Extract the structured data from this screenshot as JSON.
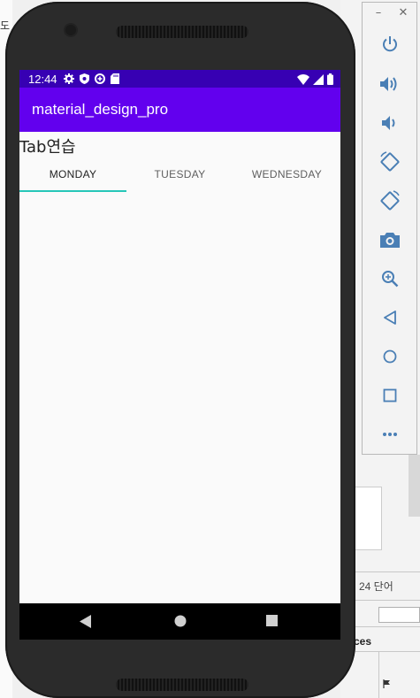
{
  "background": {
    "word_count": "24 단어",
    "panel_fragment": "ces",
    "left_fragment": "도"
  },
  "status_bar": {
    "time": "12:44",
    "bg_color": "#3700b3"
  },
  "app_bar": {
    "title": "material_design_pro",
    "bg_color": "#6200ee"
  },
  "content": {
    "heading": "Tab연습"
  },
  "tabs": [
    {
      "label": "MONDAY",
      "active": true
    },
    {
      "label": "TUESDAY",
      "active": false
    },
    {
      "label": "WEDNESDAY",
      "active": false
    }
  ],
  "tab_indicator_color": "#26c6b8",
  "nav_bar": {
    "buttons": [
      "back-icon",
      "home-icon",
      "recents-icon"
    ]
  },
  "emulator_toolbar": {
    "window_controls": {
      "minimize": "–",
      "close": "✕"
    },
    "buttons": [
      "power-icon",
      "volume-up-icon",
      "volume-down-icon",
      "rotate-left-icon",
      "rotate-right-icon",
      "camera-icon",
      "zoom-icon",
      "back-icon",
      "home-icon",
      "overview-icon",
      "more-icon"
    ]
  }
}
